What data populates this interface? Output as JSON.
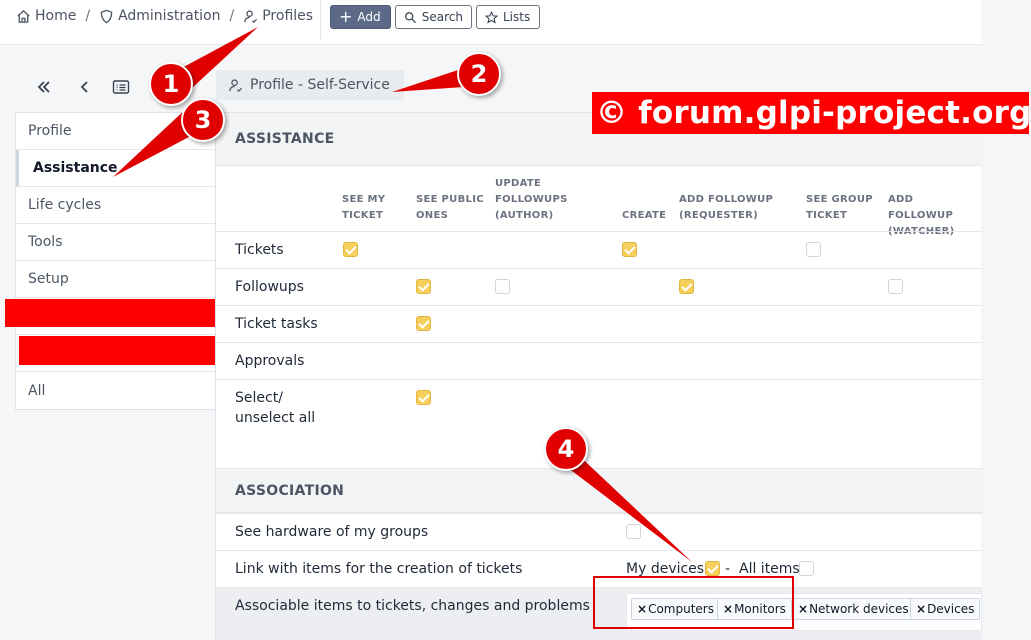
{
  "breadcrumb": {
    "home": "Home",
    "administration": "Administration",
    "profiles": "Profiles",
    "separator": "/"
  },
  "toolbar": {
    "add": "Add",
    "search": "Search",
    "lists": "Lists"
  },
  "profile_title": "Profile - Self-Service",
  "tabs": [
    "Profile",
    "Assistance",
    "Life cycles",
    "Tools",
    "Setup",
    "",
    "",
    "All"
  ],
  "assistance": {
    "heading": "ASSISTANCE",
    "columns": [
      [
        "SEE MY",
        "TICKET"
      ],
      [
        "SEE PUBLIC",
        "ONES"
      ],
      [
        "UPDATE",
        "FOLLOWUPS",
        "(AUTHOR)"
      ],
      [
        "CREATE"
      ],
      [
        "ADD FOLLOWUP",
        "(REQUESTER)"
      ],
      [
        "SEE GROUP",
        "TICKET"
      ],
      [
        "ADD FOLLOWUP",
        "(WATCHER)"
      ]
    ],
    "rows": [
      {
        "label": "Tickets",
        "checks": [
          true,
          null,
          null,
          true,
          null,
          false,
          null
        ]
      },
      {
        "label": "Followups",
        "checks": [
          null,
          true,
          false,
          null,
          true,
          null,
          false
        ]
      },
      {
        "label": "Ticket tasks",
        "checks": [
          null,
          true,
          null,
          null,
          null,
          null,
          null
        ]
      },
      {
        "label": "Approvals",
        "checks": [
          null,
          null,
          null,
          null,
          null,
          null,
          null
        ]
      },
      {
        "label": "Select/\nunselect all",
        "checks": [
          null,
          true,
          null,
          null,
          null,
          null,
          null
        ]
      }
    ]
  },
  "association": {
    "heading": "ASSOCIATION",
    "see_hardware": {
      "label": "See hardware of my groups",
      "checked": false
    },
    "link_items": {
      "label": "Link with items for the creation of tickets",
      "my_devices": "My devices",
      "my_devices_checked": true,
      "dash": "-",
      "all_items": "All items",
      "all_items_checked": false
    },
    "associable": {
      "label": "Associable items to tickets, changes and problems",
      "tags": [
        "Computers",
        "Monitors",
        "Network devices",
        "Devices"
      ]
    }
  },
  "watermark": "© forum.glpi-project.org",
  "callouts": [
    "1",
    "2",
    "3",
    "4"
  ],
  "colors": {
    "annotation_red": "#e00000",
    "checkbox_on": "#f6cf5c",
    "add_button": "#5c6a87"
  }
}
